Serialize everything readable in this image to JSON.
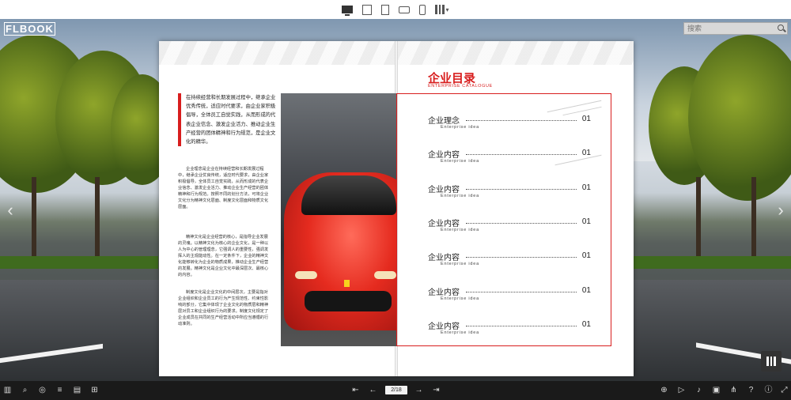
{
  "app": {
    "logo": "FLBOOK"
  },
  "device_bar": {
    "modes": [
      "desktop-icon",
      "tablet-landscape-icon",
      "tablet-portrait-icon",
      "phone-landscape-icon",
      "phone-portrait-icon",
      "qr-code-icon"
    ]
  },
  "search": {
    "placeholder": "搜索"
  },
  "left_page": {
    "quote": "在持续经营和长期发展过程中，继承企业优秀传统，适应时代要求，由企业家积极倡导，全体员工自觉实践，从而形成的代表企业信念、激发企业活力、推动企业生产经营的团体精神和行为规范，是企业文化的精华。",
    "para1": "企业理念是企业在持续经营和长期发展过程中，继承企业优良传统，适应时代要求，由企业家积极倡导，全体员工自觉实践，从而形成的代表企业信念、激发企业活力、推动企业生产经营的团体精神和行为规范。按照不同的划分方法，可将企业文化分为精神文化层面、制度文化层面和物质文化层面。",
    "para2": "精神文化是企业经营的核心，是指导企业发展的灵魂。以精神文化为核心的企业文化，是一种以人为中心的管理理念，它强调人的重要性，强调发挥人的主观能动性。在一定条件下，企业的精神文化能够转化为企业的物质成果，推动企业生产经营的发展。精神文化是企业文化中最深层次、最核心的内容。",
    "para3": "制度文化是企业文化的中间层次，主要是指对企业组织和企业员工的行为产生规范性、约束性影响的部分，它集中体现了企业文化的物质层和精神层对员工和企业组织行为的要求。制度文化规定了企业成员在共同的生产经营活动中所应当遵循的行动准则。"
  },
  "right_page": {
    "title": "企业目录",
    "subtitle": "ENTERPRISE CATALOGUE",
    "items": [
      {
        "label": "企业理念",
        "sub": "Enterprise idea",
        "page": "01"
      },
      {
        "label": "企业内容",
        "sub": "Enterprise idea",
        "page": "01"
      },
      {
        "label": "企业内容",
        "sub": "Enterprise idea",
        "page": "01"
      },
      {
        "label": "企业内容",
        "sub": "Enterprise idea",
        "page": "01"
      },
      {
        "label": "企业内容",
        "sub": "Enterprise idea",
        "page": "01"
      },
      {
        "label": "企业内容",
        "sub": "Enterprise idea",
        "page": "01"
      },
      {
        "label": "企业内容",
        "sub": "Enterprise idea",
        "page": "01"
      }
    ]
  },
  "toolbar": {
    "page_indicator": "2/18",
    "left_icons": [
      "thumbnails-icon",
      "search-icon",
      "share-globe-icon",
      "text-icon",
      "bookmark-icon",
      "grid-icon"
    ],
    "right_icons": [
      "zoom-in-icon",
      "autoplay-icon",
      "sound-icon",
      "print-icon",
      "share-icon",
      "help-icon",
      "info-icon",
      "fullscreen-icon"
    ]
  }
}
